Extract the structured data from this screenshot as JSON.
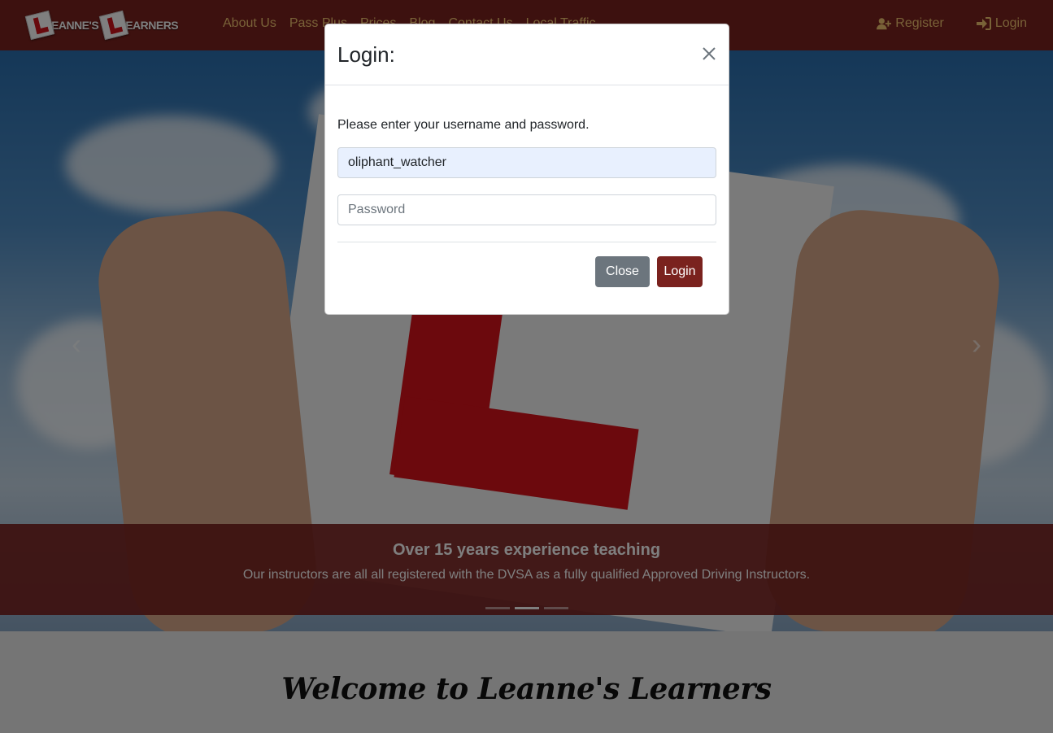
{
  "brand": {
    "word1": "EANNE'S",
    "word2": "EARNERS"
  },
  "nav": {
    "links": [
      "About Us",
      "Pass Plus",
      "Prices",
      "Blog",
      "Contact Us",
      "Local Traffic"
    ],
    "register_label": "Register",
    "login_label": "Login"
  },
  "hero": {
    "caption_title": "Over 15 years experience teaching",
    "caption_text": "Our instructors are all all registered with the DVSA as a fully qualified Approved Driving Instructors.",
    "prev_arrow": "‹",
    "next_arrow": "›",
    "slide_count": 3,
    "active_slide": 2
  },
  "welcome": {
    "title": "Welcome to Leanne's Learners"
  },
  "modal": {
    "title": "Login:",
    "message": "Please enter your username and password.",
    "username_value": "oliphant_watcher",
    "password_placeholder": "Password",
    "close_label": "Close",
    "login_label": "Login"
  },
  "colors": {
    "brand": "#7a221e",
    "nav_link": "#f2c471",
    "secondary": "#6c757d",
    "autofill": "#e8f0fe"
  },
  "icons": {
    "close": "close-icon",
    "register": "user-plus-icon",
    "login": "sign-in-icon"
  }
}
